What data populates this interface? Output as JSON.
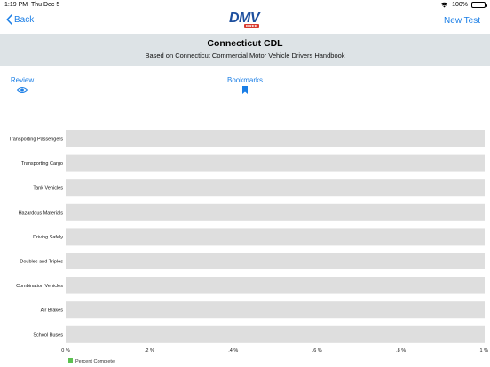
{
  "status_bar": {
    "time": "1:19 PM",
    "date": "Thu Dec 5",
    "battery": "100%"
  },
  "nav": {
    "back_label": "Back",
    "new_test_label": "New Test",
    "logo_text": "DMV",
    "logo_badge": "PREP"
  },
  "header": {
    "title": "Connecticut CDL",
    "subtitle": "Based on Connecticut Commercial Motor Vehicle Drivers Handbook"
  },
  "tabs": {
    "review_label": "Review",
    "bookmarks_label": "Bookmarks"
  },
  "colors": {
    "accent": "#1a7ee6",
    "header_band": "#dde3e6",
    "bar_track": "#dedede",
    "legend_swatch": "#5cc151"
  },
  "chart_data": {
    "type": "bar",
    "orientation": "horizontal",
    "categories": [
      "Transporting Passengers",
      "Transporting Cargo",
      "Tank Vehicles",
      "Hazardous Materials",
      "Driving Safely",
      "Doubles and Triples",
      "Combination Vehicles",
      "Air Brakes",
      "School Buses"
    ],
    "series": [
      {
        "name": "Percent Complete",
        "values": [
          0,
          0,
          0,
          0,
          0,
          0,
          0,
          0,
          0
        ]
      }
    ],
    "xlim": [
      0,
      1
    ],
    "x_ticks": [
      "0 %",
      ".2 %",
      ".4 %",
      ".6 %",
      ".8 %",
      "1 %"
    ],
    "grid": false,
    "legend": "bottom-left"
  }
}
